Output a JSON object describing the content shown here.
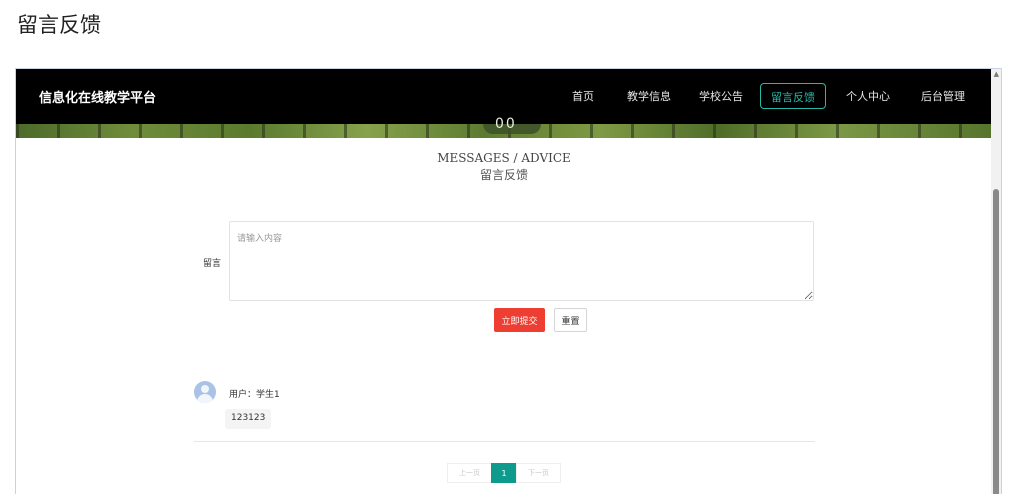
{
  "page": {
    "heading": "留言反馈"
  },
  "navbar": {
    "brand": "信息化在线教学平台",
    "items": [
      {
        "label": "首页",
        "active": false
      },
      {
        "label": "教学信息",
        "active": false
      },
      {
        "label": "学校公告",
        "active": false
      },
      {
        "label": "留言反馈",
        "active": true
      },
      {
        "label": "个人中心",
        "active": false
      },
      {
        "label": "后台管理",
        "active": false
      }
    ]
  },
  "hero": {
    "badge_text": "00"
  },
  "section": {
    "title_en": "MESSAGES / ADVICE",
    "title_cn": "留言反馈"
  },
  "form": {
    "label": "留言",
    "placeholder": "请输入内容",
    "value": "",
    "submit_label": "立即提交",
    "reset_label": "重置"
  },
  "comments": [
    {
      "user": "用户：学生1",
      "content": "123123"
    }
  ],
  "pagination": {
    "prev": "上一页",
    "current": "1",
    "next": "下一页"
  },
  "colors": {
    "navbar": "#000000",
    "accent": "#27b9a8",
    "submit": "#ee3e32",
    "page_active": "#0e9a8c"
  }
}
